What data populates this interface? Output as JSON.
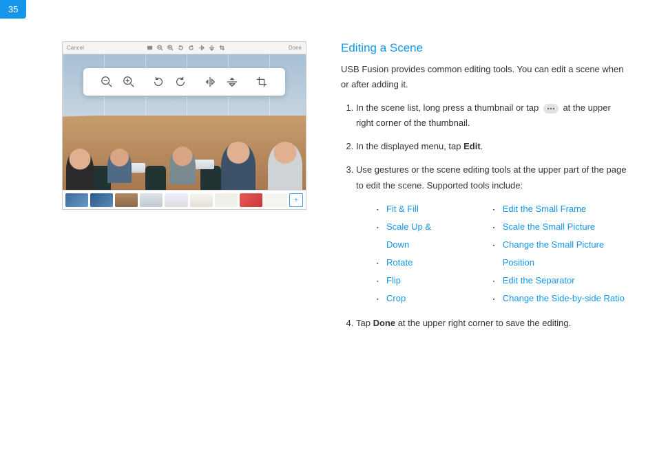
{
  "page_number": "35",
  "heading": "Editing a Scene",
  "intro": "USB Fusion provides common editing tools. You can edit a scene when or after adding it.",
  "steps": {
    "s1_a": "In the scene list, long press a thumbnail or tap ",
    "s1_b": " at the upper right corner of the thumbnail.",
    "s2_a": "In the displayed menu, tap ",
    "s2_edit": "Edit",
    "s2_b": ".",
    "s3": "Use gestures or the scene editing tools at the upper part of the page to edit the scene. Supported tools include:",
    "s4_a": "Tap ",
    "s4_done": "Done",
    "s4_b": " at the upper right corner to save the editing."
  },
  "tools_left": [
    "Fit & Fill",
    "Scale Up & Down",
    "Rotate",
    "Flip",
    "Crop"
  ],
  "tools_right": [
    "Edit the Small Frame",
    "Scale the Small Picture",
    "Change the Small Picture Position",
    "Edit the Separator",
    "Change the Side-by-side Ratio"
  ],
  "screenshot": {
    "topbar_left": "Cancel",
    "topbar_right": "Done",
    "add_label": "+"
  },
  "icons": {
    "more": "more-icon",
    "zoom_out": "zoom-out-icon",
    "zoom_in": "zoom-in-icon",
    "rotate_ccw": "rotate-ccw-icon",
    "rotate_cw": "rotate-cw-icon",
    "flip_h": "flip-horizontal-icon",
    "flip_v": "flip-vertical-icon",
    "crop": "crop-icon",
    "fit": "fit-fill-icon"
  }
}
